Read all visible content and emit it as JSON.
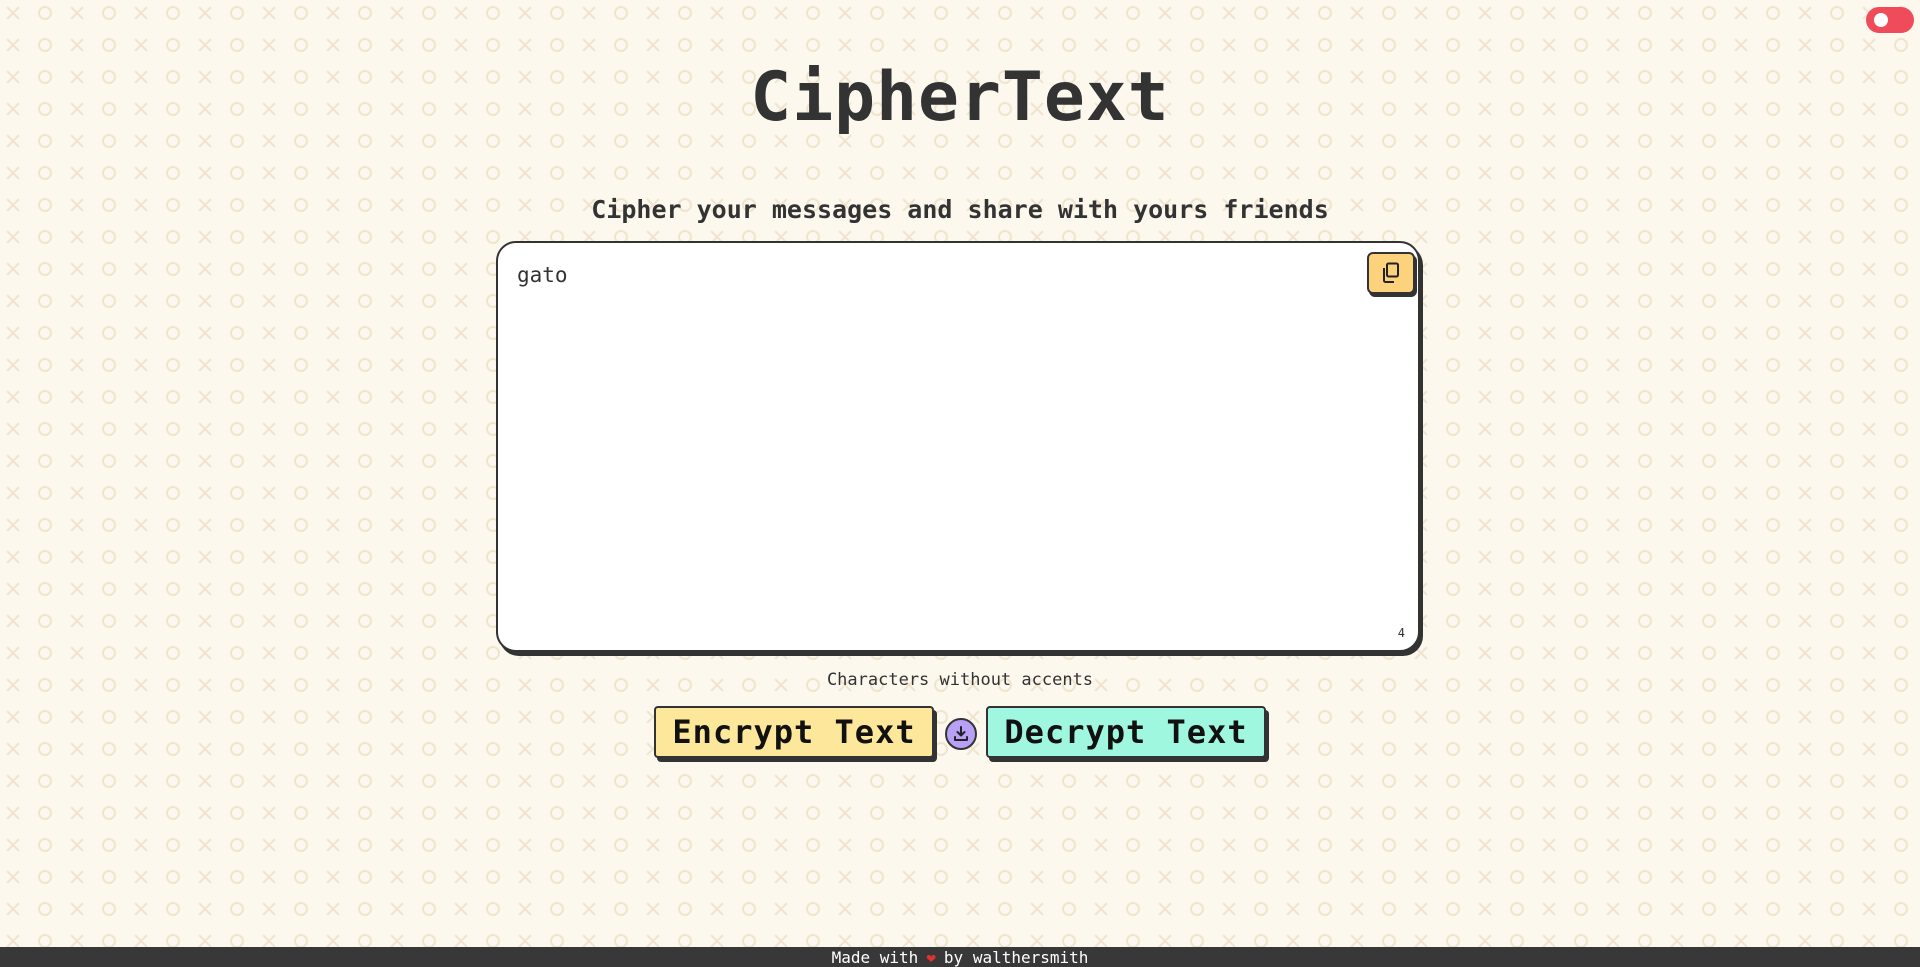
{
  "app": {
    "title": "CipherText",
    "subtitle": "Cipher your messages and share with yours friends"
  },
  "editor": {
    "value": "gato",
    "char_count": "4",
    "copy_icon": "copy-icon"
  },
  "hint": "Characters without accents",
  "actions": {
    "encrypt_label": "Encrypt Text",
    "decrypt_label": "Decrypt Text",
    "swap_icon": "download-icon"
  },
  "theme_toggle": {
    "state": "on",
    "color": "#ef4b5a"
  },
  "footer": {
    "prefix": "Made with",
    "heart": "❤",
    "suffix": "by walthersmith"
  },
  "colors": {
    "background": "#fcf8ee",
    "pattern": "#efe5d0",
    "text": "#333333",
    "encrypt": "#fde79a",
    "decrypt": "#9ff7df",
    "swap": "#b9a0f7",
    "copy": "#fcd27c",
    "footer_bg": "#383838"
  }
}
